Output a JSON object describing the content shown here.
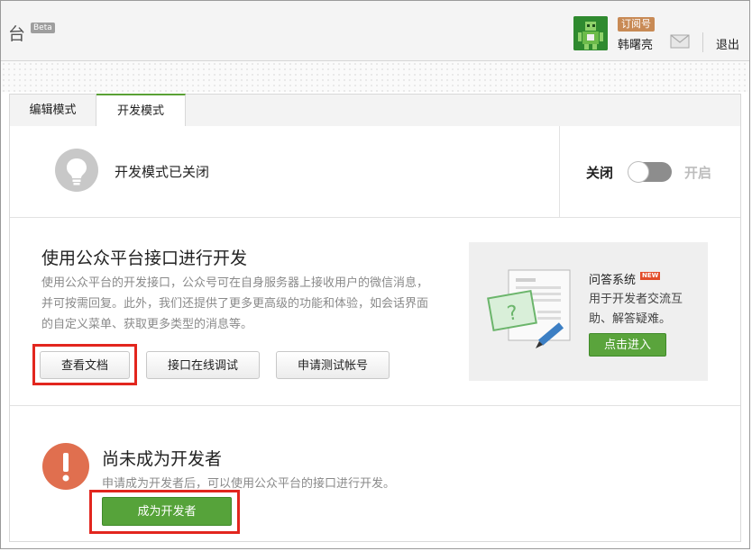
{
  "header": {
    "brand": "台",
    "beta": "Beta",
    "account_type": "订阅号",
    "user_name": "韩曙亮",
    "logout": "退出"
  },
  "tabs": [
    {
      "label": "编辑模式",
      "active": false
    },
    {
      "label": "开发模式",
      "active": true
    }
  ],
  "status": {
    "text": "开发模式已关闭",
    "toggle_off_label": "关闭",
    "toggle_on_label": "开启",
    "enabled": false
  },
  "api": {
    "title": "使用公众平台接口进行开发",
    "description": "使用公众平台的开发接口，公众号可在自身服务器上接收用户的微信消息，并可按需回复。此外，我们还提供了更多更高级的功能和体验，如会话界面的自定义菜单、获取更多类型的消息等。",
    "buttons": {
      "docs": "查看文档",
      "debug": "接口在线调试",
      "test_account": "申请测试帐号"
    }
  },
  "qa": {
    "title": "问答系统",
    "badge": "NEW",
    "description": "用于开发者交流互助、解答疑难。",
    "enter": "点击进入"
  },
  "developer": {
    "title": "尚未成为开发者",
    "description": "申请成为开发者后，可以使用公众平台的接口进行开发。",
    "button": "成为开发者"
  },
  "colors": {
    "accent_green": "#5aa43c",
    "highlight_red": "#e2261e",
    "warning_orange": "#e06f4f",
    "account_badge": "#c88a55"
  }
}
